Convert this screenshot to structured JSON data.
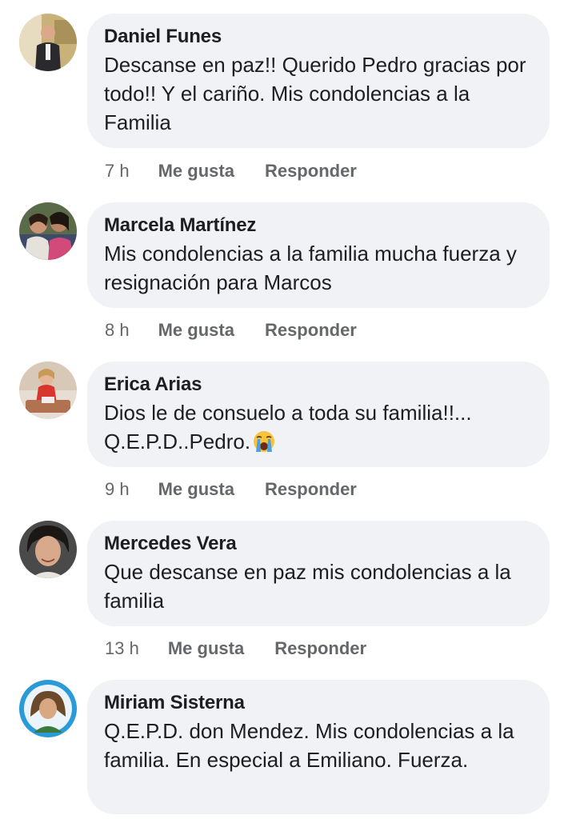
{
  "comments": [
    {
      "author": "Daniel Funes",
      "text": "Descanse en paz!! Querido Pedro gracias por todo!! Y el cariño. Mis condolencias a la Familia",
      "time": "7 h",
      "like_label": "Me gusta",
      "reply_label": "Responder"
    },
    {
      "author": "Marcela Martínez",
      "text": "Mis condolencias a la familia mucha fuerza y resignación para Marcos",
      "time": "8 h",
      "like_label": "Me gusta",
      "reply_label": "Responder"
    },
    {
      "author": "Erica Arias",
      "text": "Dios le de consuelo a toda su familia!!... Q.E.P.D..Pedro.",
      "emoji": "loudly-crying-face",
      "time": "9 h",
      "like_label": "Me gusta",
      "reply_label": "Responder"
    },
    {
      "author": "Mercedes Vera",
      "text": "Que descanse en paz mis condolencias a la familia",
      "time": "13 h",
      "like_label": "Me gusta",
      "reply_label": "Responder"
    },
    {
      "author": "Miriam Sisterna",
      "text": "Q.E.P.D. don Mendez. Mis condolencias a la familia. En especial a Emiliano. Fuerza."
    }
  ],
  "colors": {
    "bubble_bg": "#f0f2f5",
    "text": "#1c1e21",
    "meta": "#65676b"
  }
}
